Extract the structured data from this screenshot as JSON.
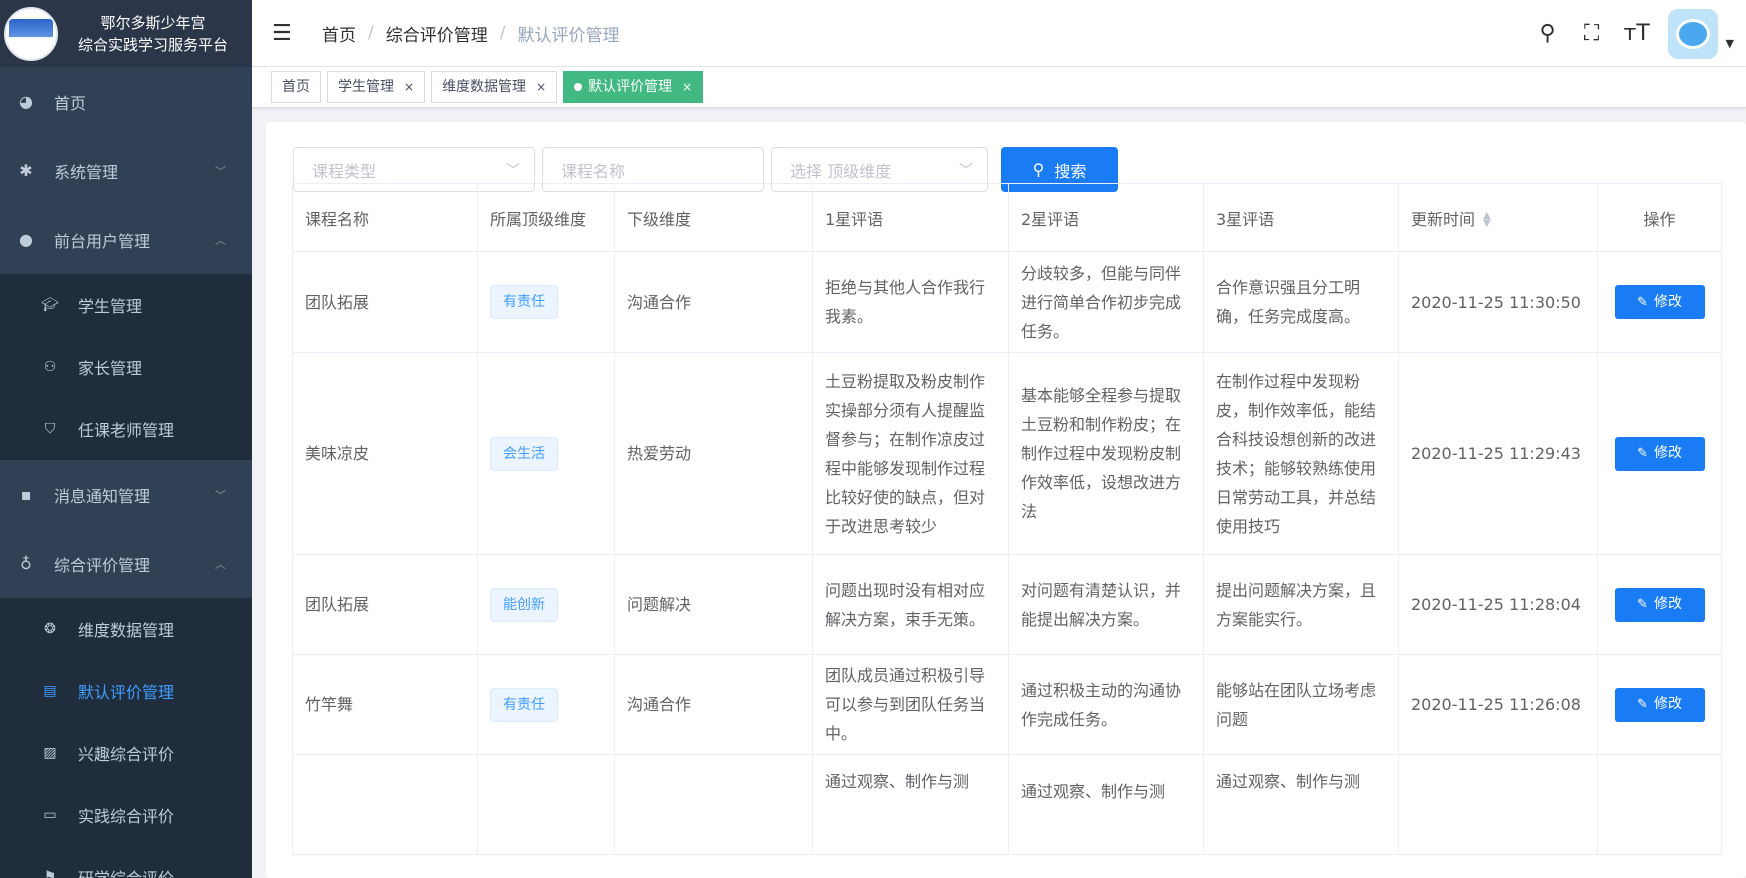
{
  "sidebar": {
    "title_line1": "鄂尔多斯少年宫",
    "title_line2": "综合实践学习服务平台",
    "items": [
      {
        "label": "首页",
        "icon": "dashboard-icon"
      },
      {
        "label": "系统管理",
        "icon": "gear-icon"
      },
      {
        "label": "前台用户管理",
        "icon": "user-icon"
      }
    ],
    "user_sub": [
      {
        "label": "学生管理",
        "icon": "graduation-cap-icon"
      },
      {
        "label": "家长管理",
        "icon": "people-icon"
      },
      {
        "label": "任课老师管理",
        "icon": "teacher-icon"
      }
    ],
    "message_item": {
      "label": "消息通知管理",
      "icon": "message-icon"
    },
    "eval_item": {
      "label": "综合评价管理",
      "icon": "award-icon"
    },
    "eval_sub": [
      {
        "label": "维度数据管理",
        "icon": "data-icon"
      },
      {
        "label": "默认评价管理",
        "icon": "document-icon"
      },
      {
        "label": "兴趣综合评价",
        "icon": "chart-icon"
      },
      {
        "label": "实践综合评价",
        "icon": "monitor-icon"
      },
      {
        "label": "研学综合评价",
        "icon": "flag-icon"
      }
    ]
  },
  "header": {
    "breadcrumb": [
      "首页",
      "综合评价管理",
      "默认评价管理"
    ],
    "separator": "/"
  },
  "tags": [
    {
      "label": "首页"
    },
    {
      "label": "学生管理"
    },
    {
      "label": "维度数据管理"
    },
    {
      "label": "默认评价管理"
    }
  ],
  "filters": {
    "course_type": "课程类型",
    "course_name": "课程名称",
    "dimension": "选择 顶级维度",
    "search_label": "搜索"
  },
  "table": {
    "headers": [
      "课程名称",
      "所属顶级维度",
      "下级维度",
      "1星评语",
      "2星评语",
      "3星评语",
      "更新时间",
      "操作"
    ],
    "edit_label": "修改",
    "rows": [
      {
        "course": "团队拓展",
        "top_dim": "有责任",
        "sub_dim": "沟通合作",
        "star1": "拒绝与其他人合作我行我素。",
        "star2": "分歧较多，但能与同伴进行简单合作初步完成任务。",
        "star3": "合作意识强且分工明确，任务完成度高。",
        "time": "2020-11-25 11:30:50"
      },
      {
        "course": "美味凉皮",
        "top_dim": "会生活",
        "sub_dim": "热爱劳动",
        "star1": "土豆粉提取及粉皮制作实操部分须有人提醒监督参与；在制作凉皮过程中能够发现制作过程比较好使的缺点，但对于改进思考较少",
        "star2": "基本能够全程参与提取土豆粉和制作粉皮；在制作过程中发现粉皮制作效率低，设想改进方法",
        "star3": "在制作过程中发现粉皮，制作效率低，能结合科技设想创新的改进技术；能够较熟练使用日常劳动工具，并总结使用技巧",
        "time": "2020-11-25 11:29:43"
      },
      {
        "course": "团队拓展",
        "top_dim": "能创新",
        "sub_dim": "问题解决",
        "star1": "问题出现时没有相对应解决方案，束手无策。",
        "star2": "对问题有清楚认识，并能提出解决方案。",
        "star3": "提出问题解决方案，且方案能实行。",
        "time": "2020-11-25 11:28:04"
      },
      {
        "course": "竹竿舞",
        "top_dim": "有责任",
        "sub_dim": "沟通合作",
        "star1": "团队成员通过积极引导可以参与到团队任务当中。",
        "star2": "通过积极主动的沟通协作完成任务。",
        "star3": "能够站在团队立场考虑问题",
        "time": "2020-11-25 11:26:08"
      },
      {
        "course": "",
        "top_dim": "",
        "sub_dim": "",
        "star1": "通过观察、制作与测",
        "star2": "通过观察、制作与测",
        "star3": "通过观察、制作与测",
        "time": ""
      }
    ]
  }
}
